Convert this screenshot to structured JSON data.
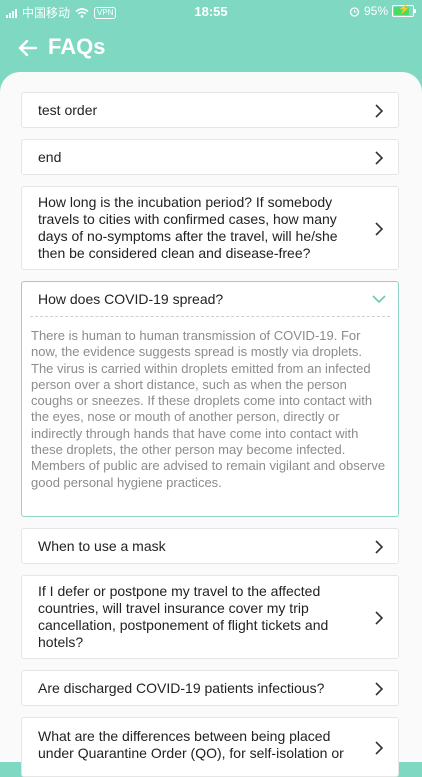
{
  "status": {
    "carrier": "中国移动",
    "vpn": "VPN",
    "time": "18:55",
    "battery": "95%",
    "battery_level": 0.95
  },
  "header": {
    "title": "FAQs",
    "back_icon": "arrow-left-icon"
  },
  "colors": {
    "accent": "#7ed8c2",
    "expanded_border": "#8fd4c4",
    "chevron_open": "#6cc8b3"
  },
  "faqs": [
    {
      "question": "test order"
    },
    {
      "question": "end"
    },
    {
      "question": "How long is the incubation period? If somebody travels to cities with confirmed cases, how many days of no-symptoms after the travel, will he/she then be considered clean and disease-free?"
    },
    {
      "question": "How does COVID-19 spread?",
      "expanded": true,
      "answer": "There is human to human transmission of COVID-19. For now, the evidence suggests spread is mostly via droplets. The virus is carried within droplets emitted from an infected person over a short distance, such as when the person coughs or sneezes. If these droplets come into contact with the eyes, nose or mouth of another person, directly or indirectly through hands that have come into contact with these droplets, the other person may become infected. Members of public are advised to remain vigilant and observe good personal hygiene practices."
    },
    {
      "question": "When to use a mask"
    },
    {
      "question": "If I defer or postpone my travel to the affected countries, will travel insurance cover my trip cancellation, postponement of flight tickets and hotels?"
    },
    {
      "question": "Are discharged COVID-19 patients infectious?"
    },
    {
      "question": "What are the differences between being placed under Quarantine Order (QO), for self-isolation or"
    }
  ]
}
